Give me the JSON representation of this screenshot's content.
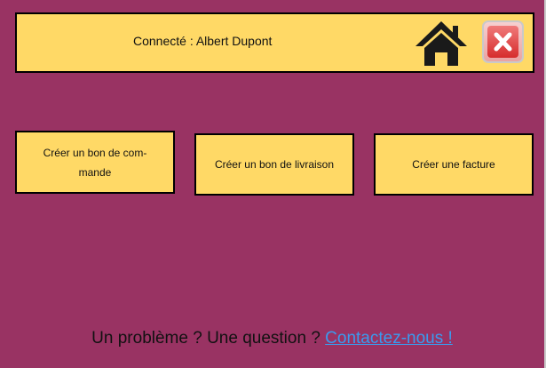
{
  "header": {
    "title": "Connecté : Albert Dupont",
    "home_icon": "home-icon",
    "close_icon": "close-icon"
  },
  "actions": [
    {
      "label": "Créer un bon de com-\nmande"
    },
    {
      "label": "Créer un bon de livraison"
    },
    {
      "label": "Créer une facture"
    }
  ],
  "footer": {
    "text": "Un problème ? Une question ? ",
    "link": "Contactez-nous !"
  },
  "colors": {
    "background": "#993363",
    "panel": "#ffd966",
    "link": "#3a9bef",
    "close": "#d62c2c"
  }
}
